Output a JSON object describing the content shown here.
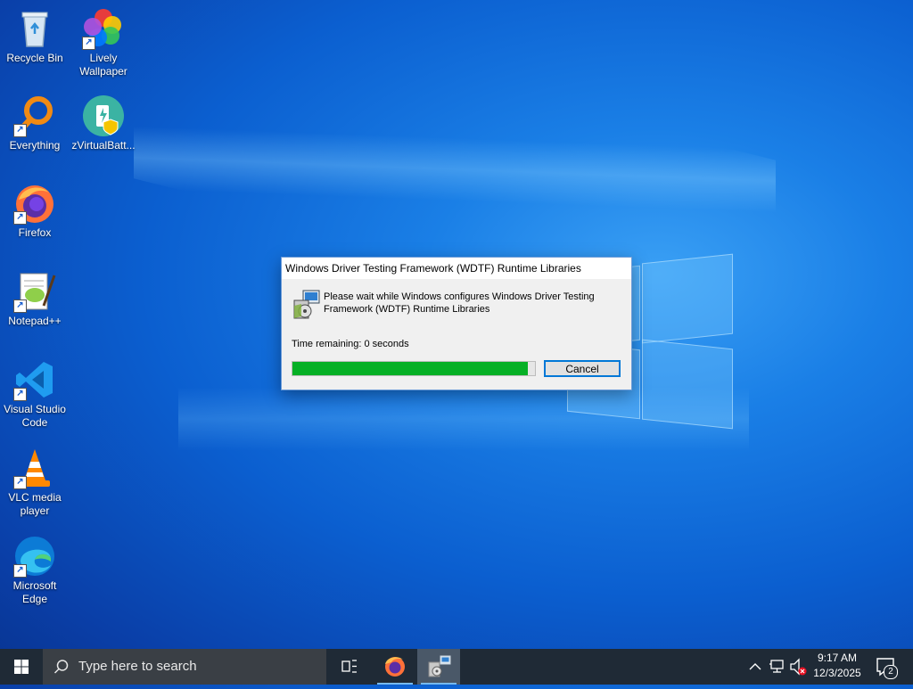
{
  "desktop": {
    "icons": [
      {
        "label": "Recycle Bin"
      },
      {
        "label": "Lively Wallpaper"
      },
      {
        "label": "Everything"
      },
      {
        "label": "zVirtualBatt..."
      },
      {
        "label": "Firefox"
      },
      {
        "label": "Notepad++"
      },
      {
        "label": "Visual Studio Code"
      },
      {
        "label": "VLC media player"
      },
      {
        "label": "Microsoft Edge"
      }
    ]
  },
  "dialog": {
    "title": "Windows Driver Testing Framework (WDTF) Runtime Libraries",
    "message": "Please wait while Windows configures Windows Driver Testing Framework (WDTF) Runtime Libraries",
    "time_remaining": "Time remaining: 0 seconds",
    "progress_fraction": 0.97,
    "cancel_label": "Cancel"
  },
  "taskbar": {
    "search_placeholder": "Type here to search",
    "time": "9:17 AM",
    "date": "12/3/2025",
    "notification_count": "2"
  },
  "colors": {
    "accent": "#0078d7",
    "progress": "#06b025",
    "taskbar": "#1f2a36"
  }
}
